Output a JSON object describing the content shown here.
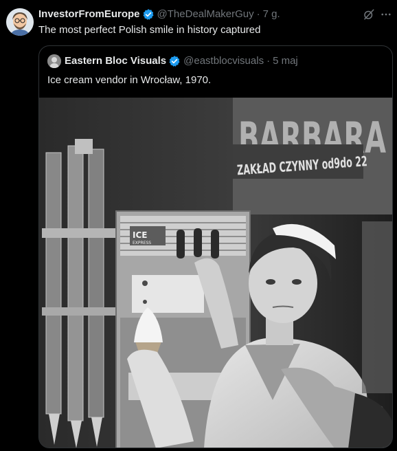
{
  "post": {
    "author_name": "InvestorFromEurope",
    "handle": "@TheDealMakerGuy",
    "separator": "·",
    "time": "7 g.",
    "text": "The most perfect Polish smile in history captured"
  },
  "quoted_post": {
    "author_name": "Eastern Bloc Visuals",
    "handle": "@eastblocvisuals",
    "separator": "·",
    "time": "5 maj",
    "text": "Ice cream vendor in Wrocław, 1970."
  },
  "photo": {
    "sign_text": "BARBARA",
    "banner_text": "ZAKŁAD CZYNNY od9do 22",
    "machine_label": "ICE",
    "machine_sub": "EXPRESS"
  },
  "colors": {
    "background": "#000000",
    "text_primary": "#e7e9ea",
    "text_secondary": "#71767b",
    "verified": "#1d9bf0",
    "border": "#2f3336"
  },
  "icons": [
    "verified-badge-icon",
    "grok-icon",
    "more-icon"
  ]
}
